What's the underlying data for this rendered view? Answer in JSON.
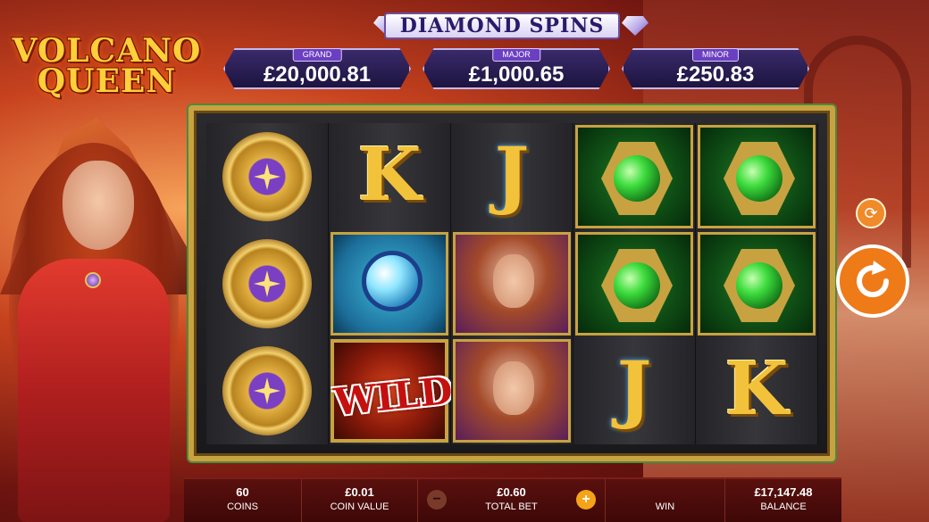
{
  "game": {
    "logo_line1": "VOLCANO",
    "logo_line2": "QUEEN",
    "colors": {
      "accent": "#ee7a18",
      "gold": "#c8a241",
      "bar": "#4a0c0a"
    }
  },
  "jackpots": {
    "title": "DIAMOND SPINS",
    "items": [
      {
        "label": "GRAND",
        "value": "£20,000.81"
      },
      {
        "label": "MAJOR",
        "value": "£1,000.65"
      },
      {
        "label": "MINOR",
        "value": "£250.83"
      }
    ]
  },
  "reels": {
    "grid": [
      [
        "compass",
        "K",
        "J",
        "green-orb",
        "green-orb"
      ],
      [
        "compass",
        "blue-orb",
        "queen",
        "green-orb",
        "green-orb"
      ],
      [
        "compass",
        "wild",
        "queen",
        "J",
        "K"
      ]
    ],
    "wild_label": "WILD"
  },
  "controls": {
    "autoplay_icon": "autoplay-icon",
    "spin_icon": "spin-arrow-icon"
  },
  "bottom_bar": {
    "coins": {
      "value": "60",
      "label": "COINS"
    },
    "coin_value": {
      "value": "£0.01",
      "label": "COIN VALUE"
    },
    "total_bet": {
      "value": "£0.60",
      "label": "TOTAL BET",
      "minus": "−",
      "plus": "+"
    },
    "win": {
      "value": "",
      "label": "WIN"
    },
    "balance": {
      "value": "£17,147.48",
      "label": "BALANCE"
    }
  }
}
